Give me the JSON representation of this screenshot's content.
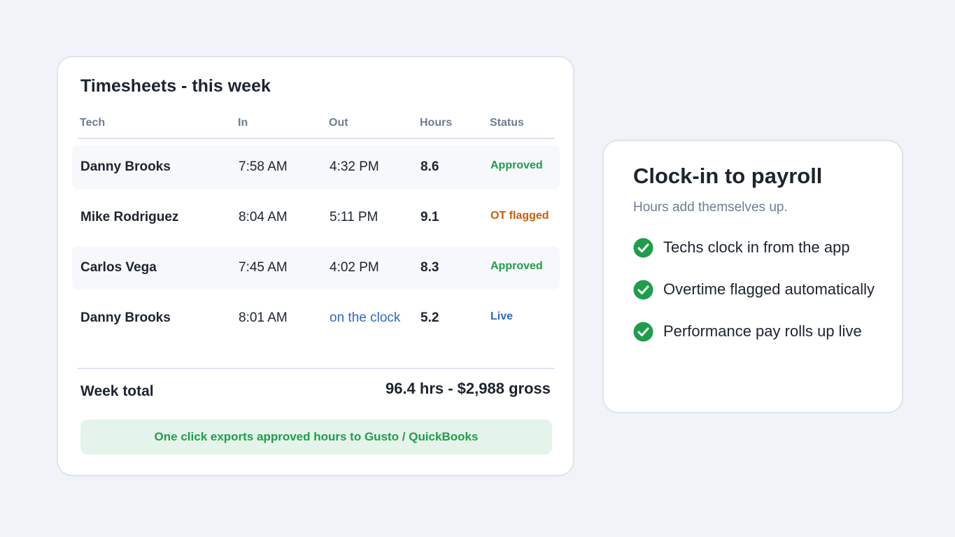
{
  "timesheet": {
    "title": "Timesheets - this week",
    "columns": {
      "tech": "Tech",
      "in": "In",
      "out": "Out",
      "hours": "Hours",
      "status": "Status"
    },
    "rows": [
      {
        "tech": "Danny Brooks",
        "in": "7:58 AM",
        "out": "4:32 PM",
        "hours": "8.6",
        "status": "Approved",
        "status_color": "#1f9d4c"
      },
      {
        "tech": "Mike Rodriguez",
        "in": "8:04 AM",
        "out": "5:11 PM",
        "hours": "9.1",
        "status": "OT flagged",
        "status_color": "#c2610c"
      },
      {
        "tech": "Carlos Vega",
        "in": "7:45 AM",
        "out": "4:02 PM",
        "hours": "8.3",
        "status": "Approved",
        "status_color": "#1f9d4c"
      },
      {
        "tech": "Danny Brooks",
        "in": "8:01 AM",
        "out": "on the clock",
        "hours": "5.2",
        "status": "Live",
        "status_color": "#2c68c9"
      }
    ],
    "week_total_label": "Week total",
    "week_total_value": "96.4 hrs - $2,988 gross",
    "export_text": "One click exports approved hours to Gusto / QuickBooks"
  },
  "info": {
    "title": "Clock-in to payroll",
    "subtitle": "Hours add themselves up.",
    "features": [
      {
        "text": "Techs clock in from the app",
        "icon": "check-circle-icon"
      },
      {
        "text": "Overtime flagged automatically",
        "icon": "check-circle-icon"
      },
      {
        "text": "Performance pay rolls up live",
        "icon": "check-circle-icon"
      }
    ]
  },
  "colors": {
    "background": "#f0f4f8",
    "approved": "#1f9d4c",
    "ot_flagged": "#c2610c",
    "live": "#2c68c9",
    "check": "#1f9d4c"
  }
}
